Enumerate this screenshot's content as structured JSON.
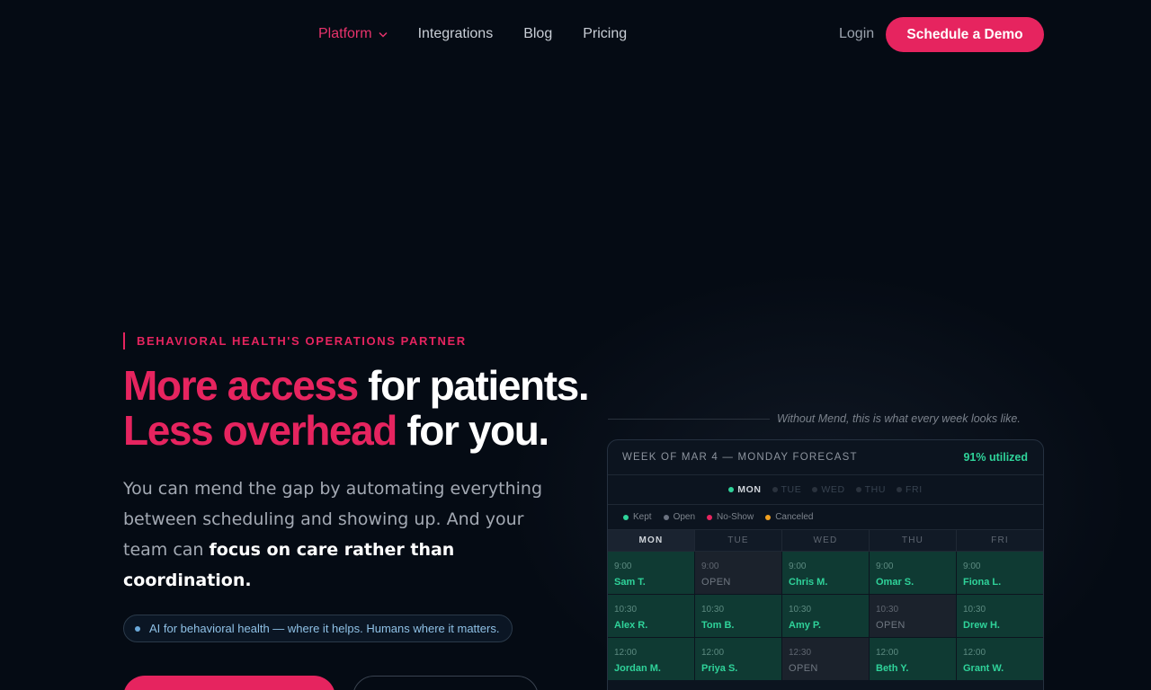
{
  "nav": {
    "links": [
      {
        "label": "Platform"
      },
      {
        "label": "Integrations"
      },
      {
        "label": "Blog"
      },
      {
        "label": "Pricing"
      }
    ],
    "login": "Login",
    "demo": "Schedule a Demo"
  },
  "hero": {
    "eyebrow": "BEHAVIORAL HEALTH'S OPERATIONS PARTNER",
    "line1_accent": "More access",
    "line1_rest": " for patients.",
    "line2_accent": "Less overhead",
    "line2_rest": " for you.",
    "sub_plain": "You can mend the gap by automating everything between scheduling and showing up. And your team can ",
    "sub_bold": "focus on care rather than coordination.",
    "pill": "AI for behavioral health — where it helps. Humans where it matters."
  },
  "panel": {
    "caption": "Without Mend, this is what every week looks like.",
    "title": "WEEK OF MAR 4 — MONDAY FORECAST",
    "utilization": "91% utilized",
    "day_tabs": [
      "MON",
      "TUE",
      "WED",
      "THU",
      "FRI"
    ],
    "legend": [
      {
        "label": "Kept",
        "color": "#2fd39a"
      },
      {
        "label": "Open",
        "color": "#6b7280"
      },
      {
        "label": "No-Show",
        "color": "#e6245f"
      },
      {
        "label": "Canceled",
        "color": "#f0a020"
      }
    ],
    "columns": [
      "MON",
      "TUE",
      "WED",
      "THU",
      "FRI"
    ],
    "rows": [
      [
        {
          "time": "9:00",
          "name": "Sam T.",
          "status": "kept"
        },
        {
          "time": "9:00",
          "name": "OPEN",
          "status": "open"
        },
        {
          "time": "9:00",
          "name": "Chris M.",
          "status": "kept"
        },
        {
          "time": "9:00",
          "name": "Omar S.",
          "status": "kept"
        },
        {
          "time": "9:00",
          "name": "Fiona L.",
          "status": "kept"
        }
      ],
      [
        {
          "time": "10:30",
          "name": "Alex R.",
          "status": "kept"
        },
        {
          "time": "10:30",
          "name": "Tom B.",
          "status": "kept"
        },
        {
          "time": "10:30",
          "name": "Amy P.",
          "status": "kept"
        },
        {
          "time": "10:30",
          "name": "OPEN",
          "status": "open"
        },
        {
          "time": "10:30",
          "name": "Drew H.",
          "status": "kept"
        }
      ],
      [
        {
          "time": "12:00",
          "name": "Jordan M.",
          "status": "kept"
        },
        {
          "time": "12:00",
          "name": "Priya S.",
          "status": "kept"
        },
        {
          "time": "12:30",
          "name": "OPEN",
          "status": "open"
        },
        {
          "time": "12:00",
          "name": "Beth Y.",
          "status": "kept"
        },
        {
          "time": "12:00",
          "name": "Grant W.",
          "status": "kept"
        }
      ]
    ]
  }
}
